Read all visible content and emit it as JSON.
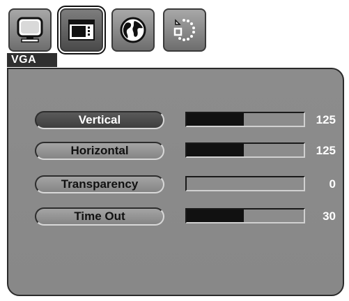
{
  "tabs": [
    {
      "icon": "monitor-icon",
      "selected": false
    },
    {
      "icon": "osd-window-icon",
      "selected": true
    },
    {
      "icon": "globe-icon",
      "selected": false
    },
    {
      "icon": "reset-dots-icon",
      "selected": false
    }
  ],
  "source_label": "VGA",
  "menu": {
    "items": [
      {
        "label": "Vertical",
        "value": "125",
        "level_percent": 49,
        "active": true
      },
      {
        "label": "Horizontal",
        "value": "125",
        "level_percent": 49,
        "active": false
      },
      {
        "label": "Transparency",
        "value": "0",
        "level_percent": 0,
        "active": false
      },
      {
        "label": "Time Out",
        "value": "30",
        "level_percent": 49,
        "active": false
      }
    ]
  },
  "colors": {
    "panel": "#8c8c8c",
    "bar_fill": "#111111",
    "active_button": "#4a4a4a"
  }
}
